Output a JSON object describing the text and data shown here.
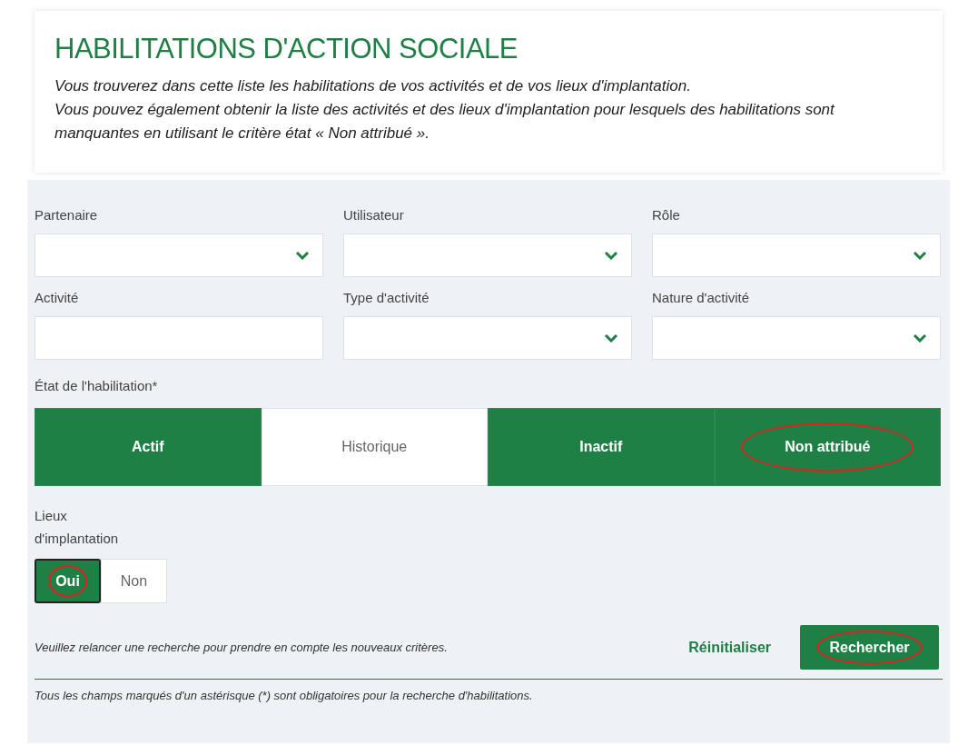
{
  "header": {
    "title": "HABILITATIONS D'ACTION SOCIALE",
    "description": [
      "Vous trouverez dans cette liste les habilitations de vos activités et de vos lieux d'implantation.",
      "Vous pouvez également obtenir la liste des activités et des lieux d'implantation pour lesquels des habilitations sont manquantes en utilisant le critère état « Non attribué »."
    ]
  },
  "fields": [
    {
      "label": "Partenaire",
      "kind": "select"
    },
    {
      "label": "Utilisateur",
      "kind": "select"
    },
    {
      "label": "Rôle",
      "kind": "select"
    },
    {
      "label": "Activité",
      "kind": "text"
    },
    {
      "label": "Type d'activité",
      "kind": "select"
    },
    {
      "label": "Nature d'activité",
      "kind": "select"
    }
  ],
  "state": {
    "label": "État de l'habilitation*",
    "options": [
      {
        "label": "Actif",
        "selected": true,
        "circled": false
      },
      {
        "label": "Historique",
        "selected": false,
        "circled": false
      },
      {
        "label": "Inactif",
        "selected": true,
        "circled": false
      },
      {
        "label": "Non attribué",
        "selected": true,
        "circled": true
      }
    ]
  },
  "locations": {
    "label_lines": [
      "Lieux",
      "d'implantation"
    ],
    "options": [
      {
        "label": "Oui",
        "selected": true,
        "circled": true
      },
      {
        "label": "Non",
        "selected": false,
        "circled": false
      }
    ]
  },
  "notice": "Veuillez relancer une recherche pour prendre en compte les nouveaux critères.",
  "reset_link": "Réinitialiser",
  "search_button": {
    "label": "Rechercher",
    "circled": true
  },
  "footnote": "Tous les champs marqués d'un astérisque (*) sont obligatoires pour la recherche d'habilitations."
}
